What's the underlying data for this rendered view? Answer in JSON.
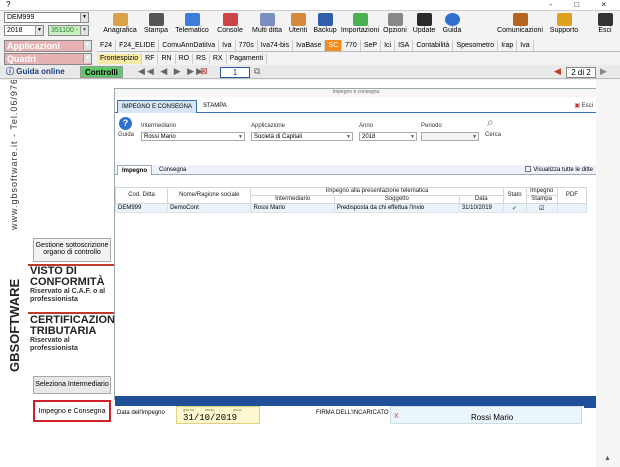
{
  "window": {
    "title": "?",
    "controls": "- □ ×"
  },
  "toolbar": {
    "company_code": "DEM999",
    "year": "2018",
    "period": "351100 -",
    "app_combo": "Applicazioni",
    "quadri_combo": "Quadri",
    "buttons": [
      "Anagrafica",
      "Stampa",
      "Telematico",
      "Console",
      "Multi ditta",
      "Utenti",
      "Backup",
      "Importazioni",
      "Opzioni",
      "Update",
      "Guida",
      "Comunicazioni",
      "Supporto",
      "Esci"
    ]
  },
  "tabs_row1": [
    "F24",
    "F24_ELIDE",
    "ComuAnnDatiIva",
    "Iva",
    "770s",
    "Iva74-bis",
    "IvaBase",
    "SC",
    "770",
    "SeP",
    "Ici",
    "ISA",
    "Contabilità",
    "Spesometro",
    "Irap",
    "Iva"
  ],
  "tabs_row1_active": "SC",
  "tabs_row2": [
    "Frontespizio",
    "RF",
    "RN",
    "RO",
    "RS",
    "RX",
    "Pagamenti"
  ],
  "tabs_row2_active": "Frontespizio",
  "nav": {
    "guida_online": "Guida online",
    "controlli": "Controlli",
    "page_value": "1",
    "page_of": "2 di 2"
  },
  "sidebar": {
    "brand_phone": "www.gbsoftware.it - Tel.06/97626",
    "brand_logo": "GBSOFTWARE",
    "btn_gestione": "Gestione sottoscrizione organo di controllo",
    "visto_title": "VISTO DI CONFORMITÀ",
    "visto_sub": "Riservato al C.A.F. o al professionista",
    "cert_title": "CERTIFICAZIONE TRIBUTARIA",
    "cert_sub": "Riservato al professionista",
    "btn_seleziona": "Seleziona Intermediario",
    "btn_impegno": "Impegno e Consegna"
  },
  "panel": {
    "header": "Impegno e consegna",
    "tab_impegno": "IMPEGNO E CONSEGNA",
    "tab_stampa": "STAMPA",
    "esci": "Esci",
    "guida_label": "Guida",
    "labels": {
      "intermediario": "Intermediario",
      "applicazione": "Applicazione",
      "anno": "Anno",
      "periodo": "Periodo",
      "cerca": "Cerca"
    },
    "values": {
      "intermediario": "Rossi Mario",
      "applicazione": "Società di Capitali",
      "anno": "2018",
      "periodo": ""
    },
    "subtab_impegno": "Impegno",
    "subtab_consegna": "Consegna",
    "visualizza": "Visualizza tutte le ditte"
  },
  "grid": {
    "group_header": "Impegno alla presentazione telematica",
    "impegno_group": "Impegno",
    "columns": [
      "Cod. Ditta",
      "Nome/Ragione sociale",
      "Intermediario",
      "Soggetto",
      "Data",
      "Stato",
      "Stampa",
      "PDF"
    ],
    "rows": [
      {
        "cod": "DEM999",
        "nome": "DemoCont",
        "intermediario": "Rossi Mario",
        "soggetto": "Predisposta da chi effettua l'invio",
        "data": "31/10/2019",
        "stato": "✔",
        "stampa": "☑",
        "pdf": ""
      }
    ]
  },
  "bottom": {
    "data_impegno_label": "Data dell'impegno",
    "cap_giorno": "giorno",
    "cap_mese": "mese",
    "cap_anno": "anno",
    "date_value": "31/10/2019",
    "firma_label": "FIRMA DELL'INCARICATO",
    "firma_x": "X",
    "firma_name": "Rossi Mario"
  },
  "colors": {
    "accent_orange": "#f28c1e",
    "accent_blue": "#1f4f96",
    "brand_red": "#c0392b",
    "control_green": "#5fc96a"
  }
}
